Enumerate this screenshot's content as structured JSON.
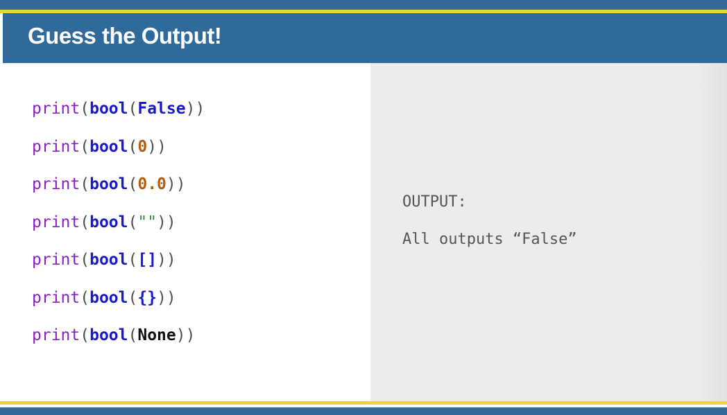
{
  "slide": {
    "title": "Guess the Output!"
  },
  "code": {
    "lines": [
      {
        "fn": "print",
        "open": "(",
        "call": "bool",
        "open2": "(",
        "arg": "False",
        "close": "))"
      },
      {
        "fn": "print",
        "open": "(",
        "call": "bool",
        "open2": "(",
        "arg": "0",
        "close": "))"
      },
      {
        "fn": "print",
        "open": "(",
        "call": "bool",
        "open2": "(",
        "arg": "0.0",
        "close": "))"
      },
      {
        "fn": "print",
        "open": "(",
        "call": "bool",
        "open2": "(",
        "arg": "\"\"",
        "close": "))"
      },
      {
        "fn": "print",
        "open": "(",
        "call": "bool",
        "open2": "(",
        "arg": "[]",
        "close": "))"
      },
      {
        "fn": "print",
        "open": "(",
        "call": "bool",
        "open2": "(",
        "arg": "{}",
        "close": "))"
      },
      {
        "fn": "print",
        "open": "(",
        "call": "bool",
        "open2": "(",
        "arg": "None",
        "close": "))"
      }
    ]
  },
  "output": {
    "label": "OUTPUT:",
    "text": "All outputs “False”"
  },
  "colors": {
    "title_bar": "#2f6a9a",
    "accent_gold": "#f2d04a",
    "keyword_print": "#8a1fc6",
    "keyword_bool": "#1a1ac4",
    "number": "#b35f12",
    "string": "#3a8a3a"
  }
}
